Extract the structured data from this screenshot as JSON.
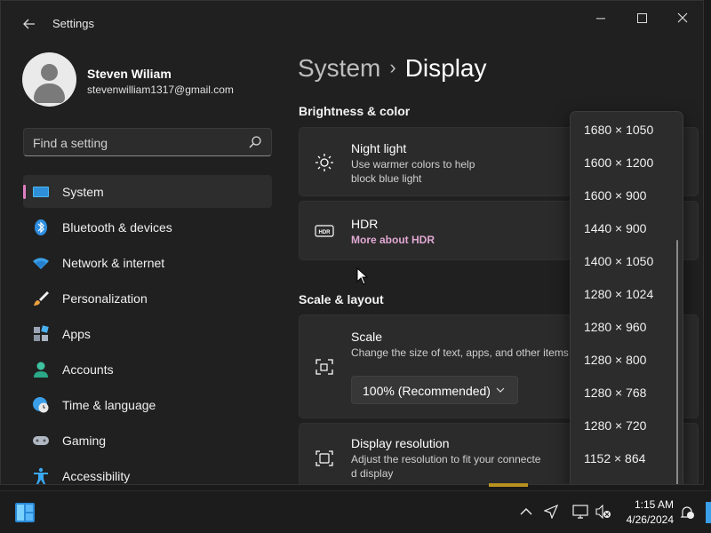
{
  "window": {
    "app_title": "Settings",
    "minimize_glyph": "─",
    "maximize_glyph": "☐",
    "close_glyph": "✕"
  },
  "profile": {
    "name": "Steven Wiliam",
    "email": "stevenwilliam1317@gmail.com"
  },
  "search": {
    "placeholder": "Find a setting"
  },
  "sidebar": {
    "items": [
      {
        "label": "System",
        "icon": "system-icon",
        "active": true
      },
      {
        "label": "Bluetooth & devices",
        "icon": "bluetooth-icon"
      },
      {
        "label": "Network & internet",
        "icon": "wifi-icon"
      },
      {
        "label": "Personalization",
        "icon": "brush-icon"
      },
      {
        "label": "Apps",
        "icon": "apps-icon"
      },
      {
        "label": "Accounts",
        "icon": "accounts-icon"
      },
      {
        "label": "Time & language",
        "icon": "globe-clock-icon"
      },
      {
        "label": "Gaming",
        "icon": "gamepad-icon"
      },
      {
        "label": "Accessibility",
        "icon": "accessibility-icon"
      }
    ]
  },
  "breadcrumb": {
    "parent": "System",
    "separator": "›",
    "current": "Display"
  },
  "sections": {
    "brightness_title": "Brightness & color",
    "scale_title": "Scale & layout"
  },
  "cards": {
    "night_light": {
      "title": "Night light",
      "subtitle_line1": "Use warmer colors to help",
      "subtitle_line2": "block blue light"
    },
    "hdr": {
      "title": "HDR",
      "link": "More about HDR"
    },
    "scale": {
      "title": "Scale",
      "subtitle": "Change the size of text, apps, and other items",
      "selected": "100% (Recommended)"
    },
    "resolution": {
      "title": "Display resolution",
      "subtitle_line1": "Adjust the resolution to fit your connecte",
      "subtitle_line2": "d display"
    }
  },
  "resolution_dropdown": {
    "options": [
      "1680 × 1050",
      "1600 × 1200",
      "1600 × 900",
      "1440 × 900",
      "1400 × 1050",
      "1280 × 1024",
      "1280 × 960",
      "1280 × 800",
      "1280 × 768",
      "1280 × 720",
      "1152 × 864"
    ]
  },
  "taskbar": {
    "time": "1:15 AM",
    "date": "4/26/2024"
  },
  "colors": {
    "accent": "#e07ec3",
    "link": "#e0a8d3",
    "window_bg": "#202020",
    "card_bg": "#2b2b2b"
  }
}
